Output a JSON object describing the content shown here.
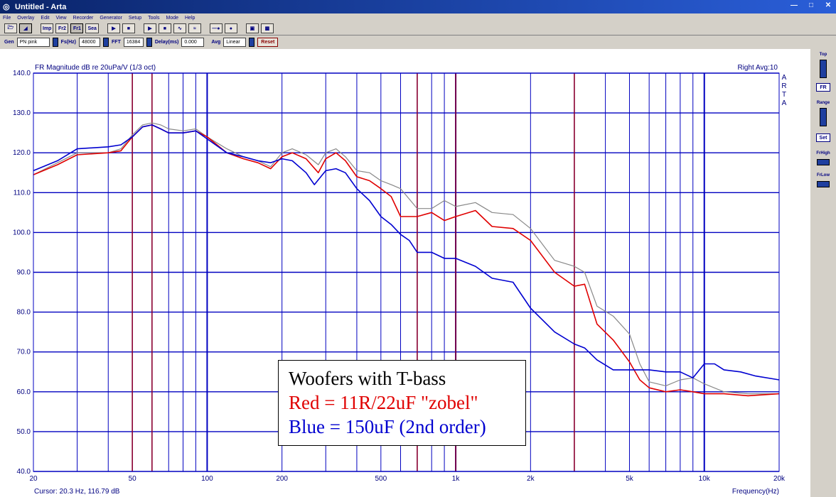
{
  "window": {
    "title": "Untitled - Arta"
  },
  "menu": [
    "File",
    "Overlay",
    "Edit",
    "View",
    "Recorder",
    "Generator",
    "Setup",
    "Tools",
    "Mode",
    "Help"
  ],
  "toolbar": {
    "buttons": [
      "Imp",
      "Fr2",
      "Fr1",
      "Sea"
    ]
  },
  "params": {
    "gen_label": "Gen",
    "gen_value": "PN pink",
    "fs_label": "Fs(Hz)",
    "fs_value": "48000",
    "fft_label": "FFT",
    "fft_value": "16384",
    "delay_label": "Delay(ms)",
    "delay_value": "0.000",
    "avg_label": "Avg",
    "avg_value": "Linear",
    "reset_label": "Reset"
  },
  "right_panel": {
    "top_label": "Top",
    "fr_button": "FR",
    "range_label": "Range",
    "set_button": "Set",
    "frhigh_label": "FrHigh",
    "frlow_label": "FrLow"
  },
  "status": {
    "cursor_text": "Cursor:  20.3 Hz, 116.79 dB",
    "xaxis_label": "Frequency(Hz)"
  },
  "legend": {
    "line1": "Woofers with T-bass",
    "line2": "Red = 11R/22uF \"zobel\"",
    "line3": "Blue = 150uF (2nd order)"
  },
  "colors": {
    "grid": "#0000c0",
    "marker": "#8b0030",
    "red": "#e00000",
    "blue": "#0000d0",
    "gray": "#888888"
  },
  "chart_data": {
    "type": "line",
    "title": "FR Magnitude dB re 20uPa/V (1/3 oct)",
    "annotation_right": "Right  Avg:10",
    "side_label": "ARTA",
    "xscale": "log",
    "xlim": [
      20,
      20000
    ],
    "ylim": [
      40,
      140
    ],
    "xlabel": "Frequency(Hz)",
    "x_ticks": [
      {
        "v": 20,
        "t": "20"
      },
      {
        "v": 50,
        "t": "50"
      },
      {
        "v": 100,
        "t": "100"
      },
      {
        "v": 200,
        "t": "200"
      },
      {
        "v": 500,
        "t": "500"
      },
      {
        "v": 1000,
        "t": "1k"
      },
      {
        "v": 2000,
        "t": "2k"
      },
      {
        "v": 5000,
        "t": "5k"
      },
      {
        "v": 10000,
        "t": "10k"
      },
      {
        "v": 20000,
        "t": "20k"
      }
    ],
    "y_ticks": [
      {
        "v": 40,
        "t": "40.0"
      },
      {
        "v": 50,
        "t": "50.0"
      },
      {
        "v": 60,
        "t": "60.0"
      },
      {
        "v": 70,
        "t": "70.0"
      },
      {
        "v": 80,
        "t": "80.0"
      },
      {
        "v": 90,
        "t": "90.0"
      },
      {
        "v": 100,
        "t": "100.0"
      },
      {
        "v": 110,
        "t": "110.0"
      },
      {
        "v": 120,
        "t": "120.0"
      },
      {
        "v": 130,
        "t": "130.0"
      },
      {
        "v": 140,
        "t": "140.0"
      }
    ],
    "marker_lines": [
      50,
      60,
      700,
      1000,
      3000
    ],
    "series": [
      {
        "color": "#888888",
        "points": [
          [
            20,
            114.5
          ],
          [
            25,
            117.5
          ],
          [
            30,
            120
          ],
          [
            40,
            120
          ],
          [
            45,
            121
          ],
          [
            50,
            124.5
          ],
          [
            55,
            127
          ],
          [
            60,
            127.5
          ],
          [
            65,
            127
          ],
          [
            70,
            126
          ],
          [
            80,
            125.5
          ],
          [
            90,
            126
          ],
          [
            100,
            124
          ],
          [
            120,
            121
          ],
          [
            140,
            119
          ],
          [
            160,
            118
          ],
          [
            180,
            116.5
          ],
          [
            200,
            120
          ],
          [
            220,
            121
          ],
          [
            250,
            119.5
          ],
          [
            280,
            117
          ],
          [
            300,
            120
          ],
          [
            330,
            121
          ],
          [
            360,
            119
          ],
          [
            400,
            115.5
          ],
          [
            450,
            115
          ],
          [
            500,
            113
          ],
          [
            550,
            112
          ],
          [
            600,
            111
          ],
          [
            700,
            106
          ],
          [
            800,
            106
          ],
          [
            900,
            108
          ],
          [
            1000,
            106.5
          ],
          [
            1200,
            107.5
          ],
          [
            1400,
            105
          ],
          [
            1700,
            104.5
          ],
          [
            2000,
            101
          ],
          [
            2500,
            93
          ],
          [
            3000,
            91.5
          ],
          [
            3300,
            90
          ],
          [
            3700,
            81.5
          ],
          [
            4300,
            79
          ],
          [
            5000,
            74.5
          ],
          [
            5500,
            67
          ],
          [
            6000,
            62.5
          ],
          [
            7000,
            61.5
          ],
          [
            8000,
            63
          ],
          [
            9000,
            63.5
          ],
          [
            10000,
            62
          ],
          [
            12000,
            60
          ],
          [
            15000,
            59.5
          ],
          [
            20000,
            59.5
          ]
        ]
      },
      {
        "color": "#e00000",
        "points": [
          [
            20,
            114.5
          ],
          [
            25,
            117
          ],
          [
            30,
            119.5
          ],
          [
            40,
            120
          ],
          [
            45,
            120.5
          ],
          [
            50,
            124
          ],
          [
            55,
            126.5
          ],
          [
            60,
            127
          ],
          [
            65,
            126
          ],
          [
            70,
            125
          ],
          [
            80,
            125
          ],
          [
            90,
            125.5
          ],
          [
            100,
            124
          ],
          [
            120,
            120
          ],
          [
            140,
            118.5
          ],
          [
            160,
            117.5
          ],
          [
            180,
            116
          ],
          [
            200,
            119
          ],
          [
            220,
            120
          ],
          [
            250,
            118.5
          ],
          [
            280,
            115
          ],
          [
            300,
            118.5
          ],
          [
            330,
            120
          ],
          [
            360,
            118
          ],
          [
            400,
            114
          ],
          [
            450,
            113
          ],
          [
            500,
            111
          ],
          [
            550,
            109
          ],
          [
            600,
            104
          ],
          [
            700,
            104
          ],
          [
            800,
            105
          ],
          [
            900,
            103
          ],
          [
            1000,
            104
          ],
          [
            1200,
            105.5
          ],
          [
            1400,
            101.5
          ],
          [
            1700,
            101
          ],
          [
            2000,
            98
          ],
          [
            2500,
            90
          ],
          [
            3000,
            86.5
          ],
          [
            3300,
            87
          ],
          [
            3700,
            77
          ],
          [
            4300,
            73
          ],
          [
            5000,
            67.5
          ],
          [
            5500,
            63
          ],
          [
            6000,
            61
          ],
          [
            7000,
            60
          ],
          [
            8000,
            60.5
          ],
          [
            9000,
            60
          ],
          [
            10000,
            59.5
          ],
          [
            12000,
            59.5
          ],
          [
            15000,
            59
          ],
          [
            20000,
            59.5
          ]
        ]
      },
      {
        "color": "#0000d0",
        "points": [
          [
            20,
            115.5
          ],
          [
            25,
            118
          ],
          [
            30,
            121
          ],
          [
            40,
            121.5
          ],
          [
            45,
            122
          ],
          [
            50,
            124
          ],
          [
            55,
            126.5
          ],
          [
            60,
            127
          ],
          [
            65,
            126
          ],
          [
            70,
            125
          ],
          [
            80,
            125
          ],
          [
            90,
            125.5
          ],
          [
            100,
            123.5
          ],
          [
            120,
            120
          ],
          [
            140,
            119
          ],
          [
            160,
            118
          ],
          [
            180,
            117.5
          ],
          [
            200,
            118.5
          ],
          [
            220,
            118
          ],
          [
            250,
            115
          ],
          [
            270,
            112
          ],
          [
            300,
            115.5
          ],
          [
            330,
            116
          ],
          [
            360,
            115
          ],
          [
            400,
            111
          ],
          [
            450,
            108
          ],
          [
            500,
            104
          ],
          [
            550,
            102
          ],
          [
            600,
            99.5
          ],
          [
            650,
            98
          ],
          [
            700,
            95
          ],
          [
            800,
            95
          ],
          [
            900,
            93.5
          ],
          [
            1000,
            93.5
          ],
          [
            1200,
            91.5
          ],
          [
            1400,
            88.5
          ],
          [
            1700,
            87.5
          ],
          [
            2000,
            81
          ],
          [
            2500,
            75
          ],
          [
            3000,
            72
          ],
          [
            3300,
            71
          ],
          [
            3700,
            68
          ],
          [
            4300,
            65.5
          ],
          [
            5000,
            65.5
          ],
          [
            6000,
            65.5
          ],
          [
            7000,
            65
          ],
          [
            8000,
            65
          ],
          [
            9000,
            63.5
          ],
          [
            10000,
            67
          ],
          [
            11000,
            67
          ],
          [
            12000,
            65.5
          ],
          [
            14000,
            65
          ],
          [
            16000,
            64
          ],
          [
            20000,
            63
          ]
        ]
      }
    ]
  }
}
